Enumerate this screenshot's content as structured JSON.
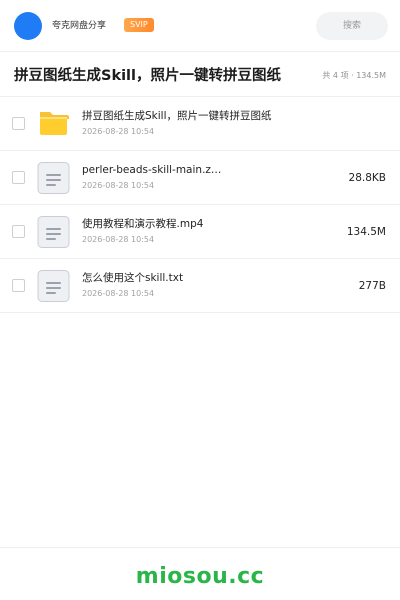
{
  "header": {
    "username": "夸克网盘分享",
    "badge": "SVIP",
    "search_label": "搜索",
    "brand_color": "#1f7cf5"
  },
  "share": {
    "title": "拼豆图纸生成Skill，照片一键转拼豆图纸",
    "meta": "共 4 项 · 134.5M"
  },
  "files": [
    {
      "name": "拼豆图纸生成Skill，照片一键转拼豆图纸",
      "date": "2026-08-28 10:54",
      "size": "",
      "icon": "folder-icon"
    },
    {
      "name": "perler-beads-skill-main.z…",
      "date": "2026-08-28 10:54",
      "size": "28.8KB",
      "icon": "file-icon"
    },
    {
      "name": "使用教程和演示教程.mp4",
      "date": "2026-08-28 10:54",
      "size": "134.5M",
      "icon": "file-icon"
    },
    {
      "name": "怎么使用这个skill.txt",
      "date": "2026-08-28 10:54",
      "size": "277B",
      "icon": "file-icon"
    }
  ],
  "footer": {
    "watermark": "miosou.cc",
    "watermark_color": "#2ab548"
  }
}
